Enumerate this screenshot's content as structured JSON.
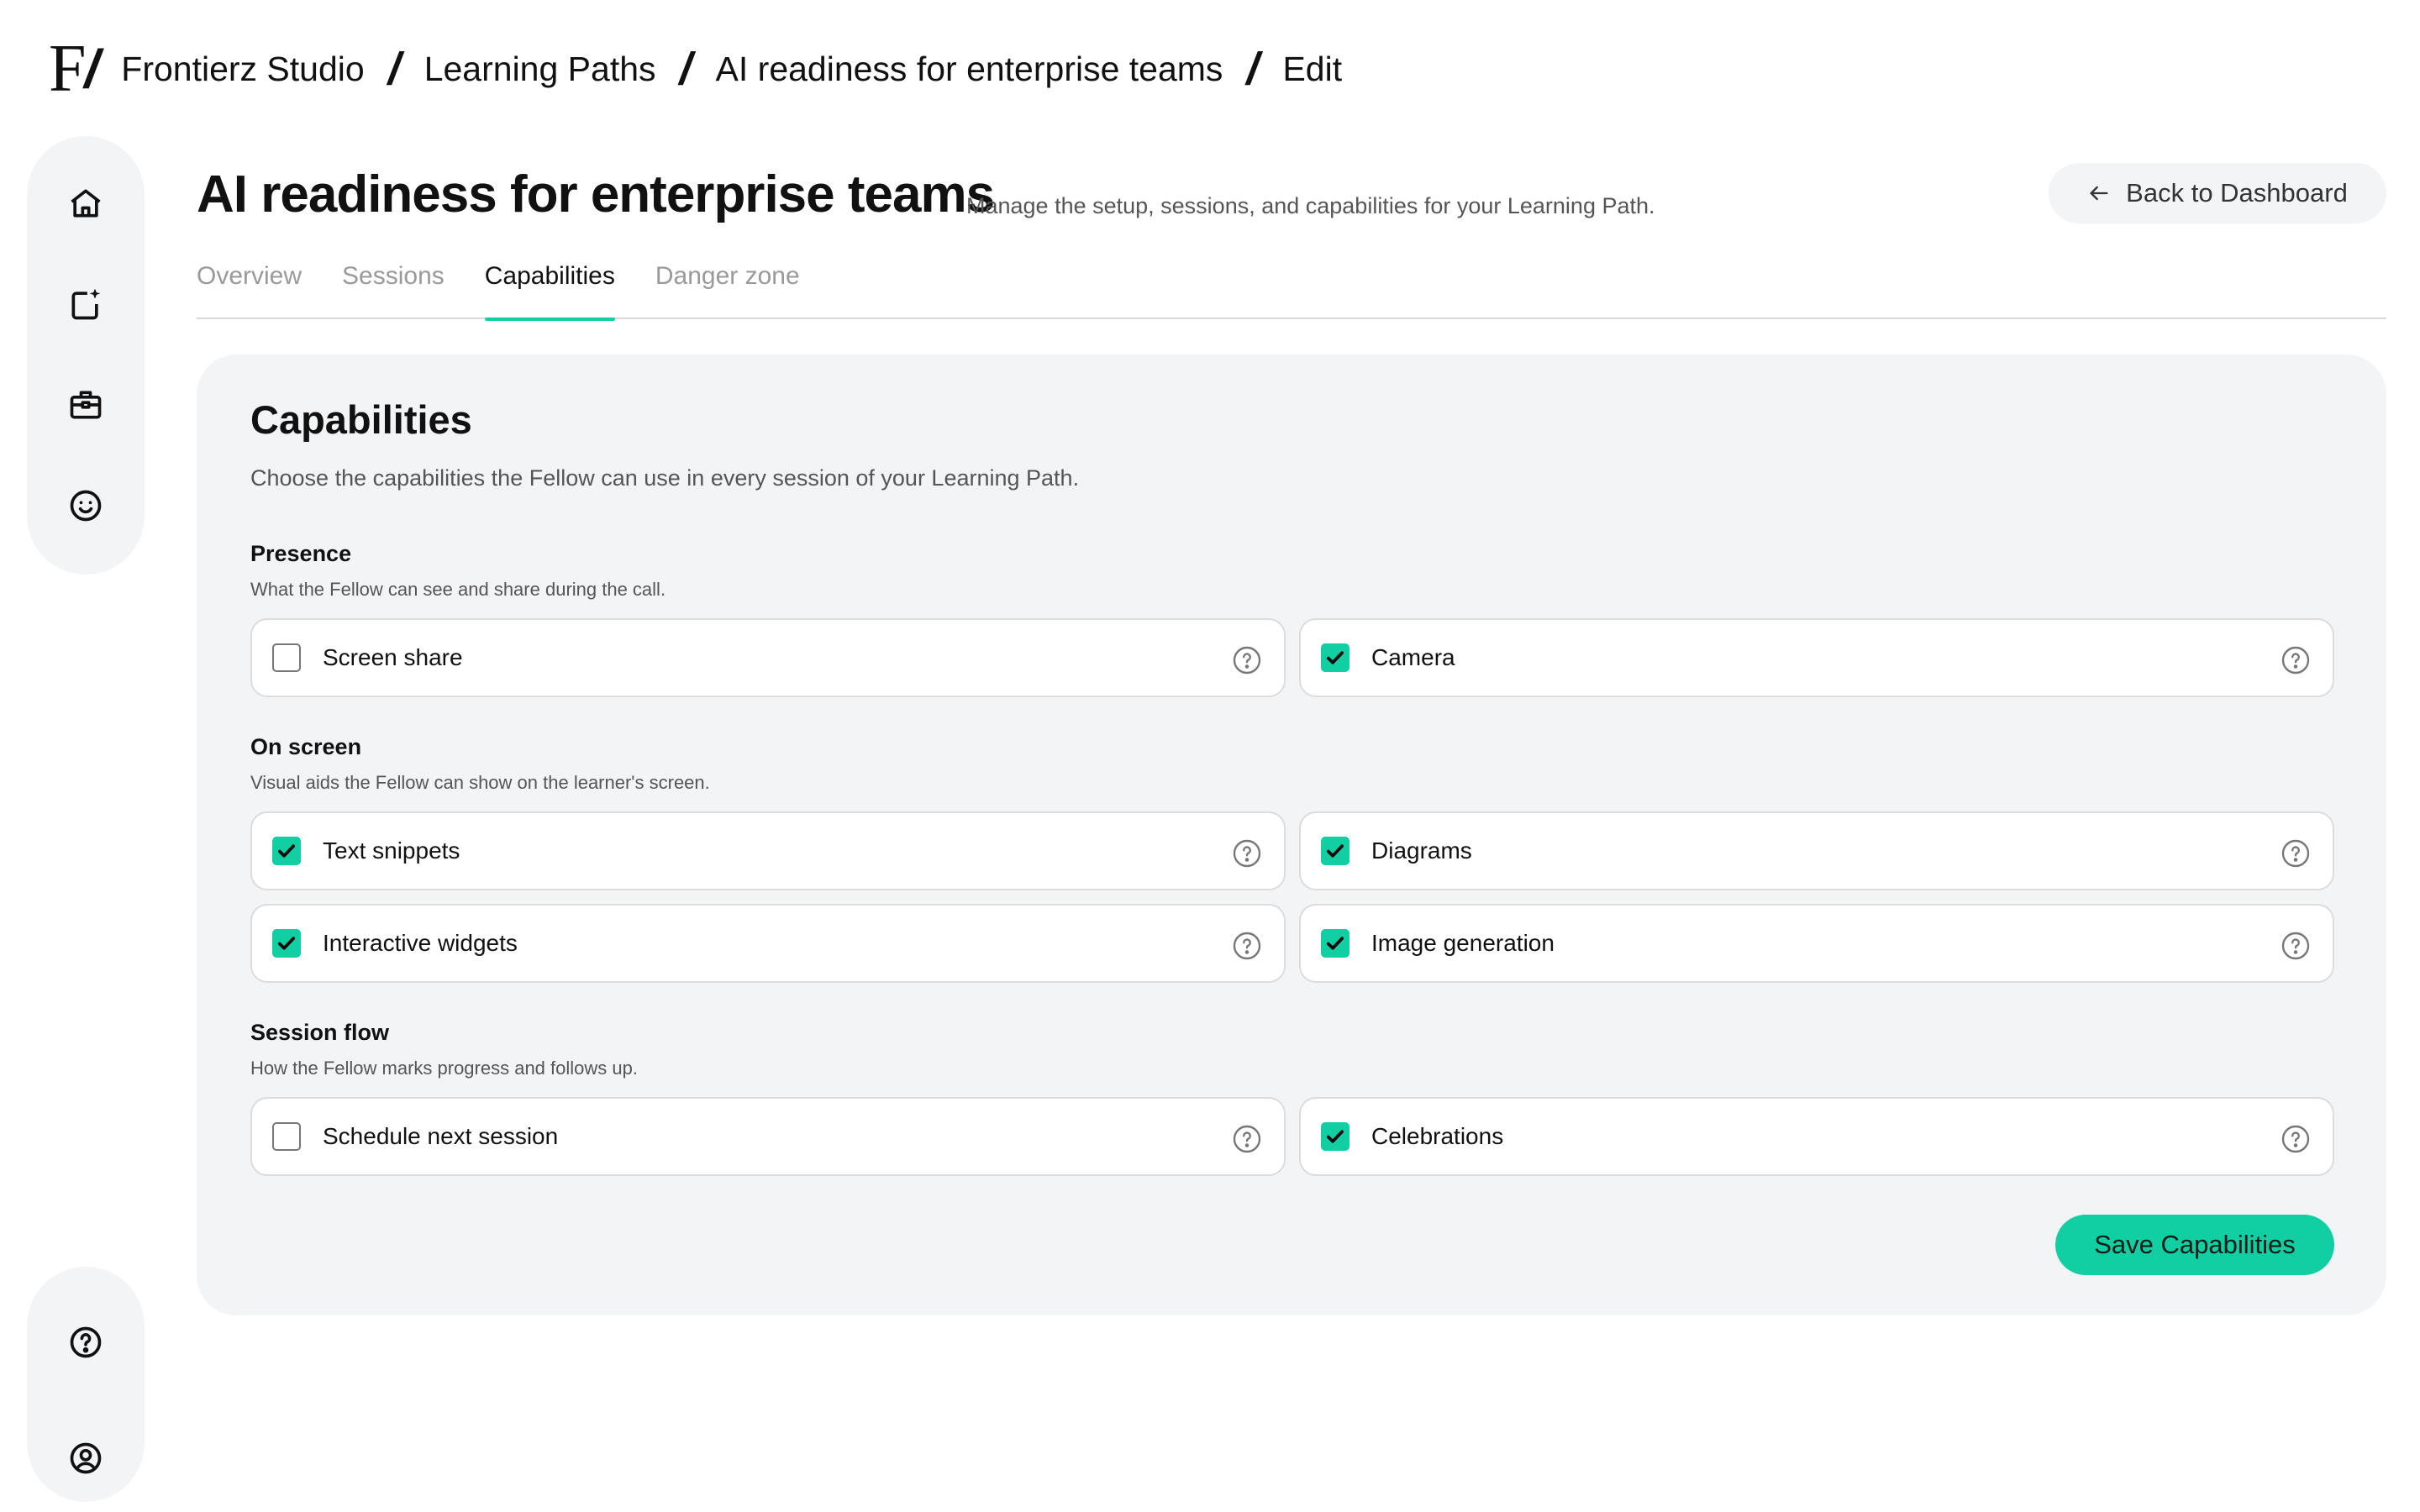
{
  "breadcrumb": {
    "logo": "F",
    "items": [
      "Frontierz Studio",
      "Learning Paths",
      "AI readiness for enterprise teams",
      "Edit"
    ]
  },
  "sidebar": {
    "top_icons": [
      "home-icon",
      "new-document-sparkle-icon",
      "briefcase-icon",
      "smiley-icon"
    ],
    "bottom_icons": [
      "help-circle-icon",
      "user-circle-icon"
    ]
  },
  "header": {
    "title": "AI readiness for enterprise teams",
    "subtitle": "Manage the setup, sessions, and capabilities for your Learning Path.",
    "back_label": "Back to Dashboard"
  },
  "tabs": [
    {
      "label": "Overview",
      "active": false
    },
    {
      "label": "Sessions",
      "active": false
    },
    {
      "label": "Capabilities",
      "active": true
    },
    {
      "label": "Danger zone",
      "active": false
    }
  ],
  "card": {
    "title": "Capabilities",
    "description": "Choose the capabilities the Fellow can use in every session of your Learning Path.",
    "sections": [
      {
        "title": "Presence",
        "description": "What the Fellow can see and share during the call.",
        "options": [
          {
            "label": "Screen share",
            "checked": false
          },
          {
            "label": "Camera",
            "checked": true
          }
        ]
      },
      {
        "title": "On screen",
        "description": "Visual aids the Fellow can show on the learner's screen.",
        "options": [
          {
            "label": "Text snippets",
            "checked": true
          },
          {
            "label": "Diagrams",
            "checked": true
          },
          {
            "label": "Interactive widgets",
            "checked": true
          },
          {
            "label": "Image generation",
            "checked": true
          }
        ]
      },
      {
        "title": "Session flow",
        "description": "How the Fellow marks progress and follows up.",
        "options": [
          {
            "label": "Schedule next session",
            "checked": false
          },
          {
            "label": "Celebrations",
            "checked": true
          }
        ]
      }
    ],
    "save_label": "Save Capabilities"
  },
  "colors": {
    "accent": "#12cfa3",
    "surface": "#f3f4f6",
    "text": "#111111",
    "muted": "#555555"
  }
}
